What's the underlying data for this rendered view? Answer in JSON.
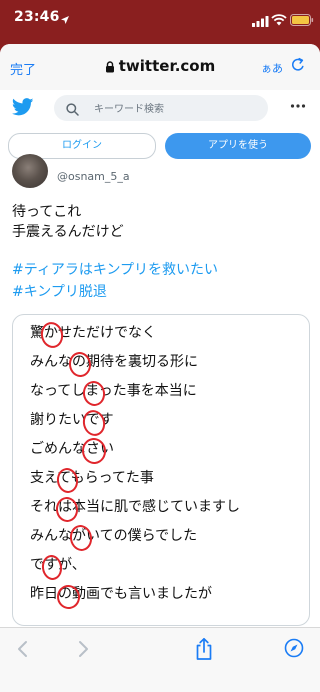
{
  "status_bar": {
    "time": "23:46"
  },
  "safari": {
    "done_label": "完了",
    "url": "twitter.com",
    "aa_label": "ぁあ"
  },
  "twitter": {
    "search_placeholder": "キーワード検索",
    "login_label": "ログイン",
    "app_label": "アプリを使う"
  },
  "tweet": {
    "handle": "@osnam_5_a",
    "text_lines": [
      "待ってこれ",
      "手震えるんだけど"
    ],
    "hashtags": [
      "#ティアラはキンプリを救いたい",
      "#キンプリ脱退"
    ]
  },
  "image_card": {
    "lines": [
      "驚かせただけでなく",
      "みんなの期待を裏切る形に",
      "なってしまった事を本当に",
      "謝りたいです",
      "ごめんなさい",
      "支えてもらってた事",
      "それは本当に肌で感じていますし",
      "みんながいての僕らでした",
      "ですが、",
      "昨日の動画でも言いましたが"
    ],
    "circle_color": "#e0262c"
  }
}
